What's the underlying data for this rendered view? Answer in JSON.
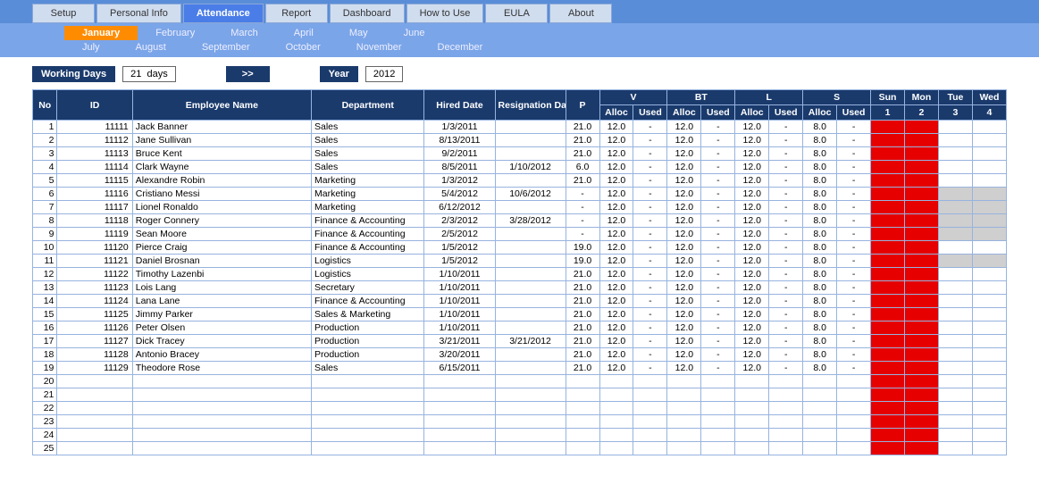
{
  "tabs": [
    "Setup",
    "Personal Info",
    "Attendance",
    "Report",
    "Dashboard",
    "How to Use",
    "EULA",
    "About"
  ],
  "activeTab": "Attendance",
  "months1": [
    "January",
    "February",
    "March",
    "April",
    "May",
    "June"
  ],
  "months2": [
    "July",
    "August",
    "September",
    "October",
    "November",
    "December"
  ],
  "activeMonth": "January",
  "controls": {
    "workingDaysLabel": "Working Days",
    "workingDaysValue": "21",
    "daysSuffix": "days",
    "nextButton": ">>",
    "yearLabel": "Year",
    "yearValue": "2012"
  },
  "headers": {
    "no": "No",
    "id": "ID",
    "name": "Employee Name",
    "dept": "Department",
    "hired": "Hired Date",
    "resig": "Resignation Date",
    "p": "P",
    "groups": [
      "V",
      "BT",
      "L",
      "S"
    ],
    "alloc": "Alloc",
    "used": "Used",
    "days": [
      "Sun",
      "Mon",
      "Tue",
      "Wed"
    ],
    "dates": [
      "1",
      "2",
      "3",
      "4"
    ]
  },
  "rows": [
    {
      "no": 1,
      "id": "11111",
      "name": "Jack Banner",
      "dept": "Sales",
      "hired": "1/3/2011",
      "resig": "",
      "p": "21.0",
      "v_a": "12.0",
      "v_u": "-",
      "bt_a": "12.0",
      "bt_u": "-",
      "l_a": "12.0",
      "l_u": "-",
      "s_a": "8.0",
      "s_u": "-",
      "d": [
        "r",
        "r",
        "",
        ""
      ]
    },
    {
      "no": 2,
      "id": "11112",
      "name": "Jane Sullivan",
      "dept": "Sales",
      "hired": "8/13/2011",
      "resig": "",
      "p": "21.0",
      "v_a": "12.0",
      "v_u": "-",
      "bt_a": "12.0",
      "bt_u": "-",
      "l_a": "12.0",
      "l_u": "-",
      "s_a": "8.0",
      "s_u": "-",
      "d": [
        "r",
        "r",
        "",
        ""
      ]
    },
    {
      "no": 3,
      "id": "11113",
      "name": "Bruce Kent",
      "dept": "Sales",
      "hired": "9/2/2011",
      "resig": "",
      "p": "21.0",
      "v_a": "12.0",
      "v_u": "-",
      "bt_a": "12.0",
      "bt_u": "-",
      "l_a": "12.0",
      "l_u": "-",
      "s_a": "8.0",
      "s_u": "-",
      "d": [
        "r",
        "r",
        "",
        ""
      ]
    },
    {
      "no": 4,
      "id": "11114",
      "name": "Clark Wayne",
      "dept": "Sales",
      "hired": "8/5/2011",
      "resig": "1/10/2012",
      "p": "6.0",
      "v_a": "12.0",
      "v_u": "-",
      "bt_a": "12.0",
      "bt_u": "-",
      "l_a": "12.0",
      "l_u": "-",
      "s_a": "8.0",
      "s_u": "-",
      "d": [
        "r",
        "r",
        "",
        ""
      ]
    },
    {
      "no": 5,
      "id": "11115",
      "name": "Alexandre Robin",
      "dept": "Marketing",
      "hired": "1/3/2012",
      "resig": "",
      "p": "21.0",
      "v_a": "12.0",
      "v_u": "-",
      "bt_a": "12.0",
      "bt_u": "-",
      "l_a": "12.0",
      "l_u": "-",
      "s_a": "8.0",
      "s_u": "-",
      "d": [
        "r",
        "r",
        "",
        ""
      ]
    },
    {
      "no": 6,
      "id": "11116",
      "name": "Cristiano Messi",
      "dept": "Marketing",
      "hired": "5/4/2012",
      "resig": "10/6/2012",
      "p": "-",
      "v_a": "12.0",
      "v_u": "-",
      "bt_a": "12.0",
      "bt_u": "-",
      "l_a": "12.0",
      "l_u": "-",
      "s_a": "8.0",
      "s_u": "-",
      "d": [
        "r",
        "r",
        "g",
        "g"
      ]
    },
    {
      "no": 7,
      "id": "11117",
      "name": "Lionel Ronaldo",
      "dept": "Marketing",
      "hired": "6/12/2012",
      "resig": "",
      "p": "-",
      "v_a": "12.0",
      "v_u": "-",
      "bt_a": "12.0",
      "bt_u": "-",
      "l_a": "12.0",
      "l_u": "-",
      "s_a": "8.0",
      "s_u": "-",
      "d": [
        "r",
        "r",
        "g",
        "g"
      ]
    },
    {
      "no": 8,
      "id": "11118",
      "name": "Roger Connery",
      "dept": "Finance & Accounting",
      "hired": "2/3/2012",
      "resig": "3/28/2012",
      "p": "-",
      "v_a": "12.0",
      "v_u": "-",
      "bt_a": "12.0",
      "bt_u": "-",
      "l_a": "12.0",
      "l_u": "-",
      "s_a": "8.0",
      "s_u": "-",
      "d": [
        "r",
        "r",
        "g",
        "g"
      ]
    },
    {
      "no": 9,
      "id": "11119",
      "name": "Sean Moore",
      "dept": "Finance & Accounting",
      "hired": "2/5/2012",
      "resig": "",
      "p": "-",
      "v_a": "12.0",
      "v_u": "-",
      "bt_a": "12.0",
      "bt_u": "-",
      "l_a": "12.0",
      "l_u": "-",
      "s_a": "8.0",
      "s_u": "-",
      "d": [
        "r",
        "r",
        "g",
        "g"
      ]
    },
    {
      "no": 10,
      "id": "11120",
      "name": "Pierce Craig",
      "dept": "Finance & Accounting",
      "hired": "1/5/2012",
      "resig": "",
      "p": "19.0",
      "v_a": "12.0",
      "v_u": "-",
      "bt_a": "12.0",
      "bt_u": "-",
      "l_a": "12.0",
      "l_u": "-",
      "s_a": "8.0",
      "s_u": "-",
      "d": [
        "r",
        "r",
        "",
        ""
      ]
    },
    {
      "no": 11,
      "id": "11121",
      "name": "Daniel Brosnan",
      "dept": "Logistics",
      "hired": "1/5/2012",
      "resig": "",
      "p": "19.0",
      "v_a": "12.0",
      "v_u": "-",
      "bt_a": "12.0",
      "bt_u": "-",
      "l_a": "12.0",
      "l_u": "-",
      "s_a": "8.0",
      "s_u": "-",
      "d": [
        "r",
        "r",
        "g",
        "g"
      ]
    },
    {
      "no": 12,
      "id": "11122",
      "name": "Timothy Lazenbi",
      "dept": "Logistics",
      "hired": "1/10/2011",
      "resig": "",
      "p": "21.0",
      "v_a": "12.0",
      "v_u": "-",
      "bt_a": "12.0",
      "bt_u": "-",
      "l_a": "12.0",
      "l_u": "-",
      "s_a": "8.0",
      "s_u": "-",
      "d": [
        "r",
        "r",
        "",
        ""
      ]
    },
    {
      "no": 13,
      "id": "11123",
      "name": "Lois Lang",
      "dept": "Secretary",
      "hired": "1/10/2011",
      "resig": "",
      "p": "21.0",
      "v_a": "12.0",
      "v_u": "-",
      "bt_a": "12.0",
      "bt_u": "-",
      "l_a": "12.0",
      "l_u": "-",
      "s_a": "8.0",
      "s_u": "-",
      "d": [
        "r",
        "r",
        "",
        ""
      ]
    },
    {
      "no": 14,
      "id": "11124",
      "name": "Lana Lane",
      "dept": "Finance & Accounting",
      "hired": "1/10/2011",
      "resig": "",
      "p": "21.0",
      "v_a": "12.0",
      "v_u": "-",
      "bt_a": "12.0",
      "bt_u": "-",
      "l_a": "12.0",
      "l_u": "-",
      "s_a": "8.0",
      "s_u": "-",
      "d": [
        "r",
        "r",
        "",
        ""
      ]
    },
    {
      "no": 15,
      "id": "11125",
      "name": "Jimmy Parker",
      "dept": "Sales & Marketing",
      "hired": "1/10/2011",
      "resig": "",
      "p": "21.0",
      "v_a": "12.0",
      "v_u": "-",
      "bt_a": "12.0",
      "bt_u": "-",
      "l_a": "12.0",
      "l_u": "-",
      "s_a": "8.0",
      "s_u": "-",
      "d": [
        "r",
        "r",
        "",
        ""
      ]
    },
    {
      "no": 16,
      "id": "11126",
      "name": "Peter Olsen",
      "dept": "Production",
      "hired": "1/10/2011",
      "resig": "",
      "p": "21.0",
      "v_a": "12.0",
      "v_u": "-",
      "bt_a": "12.0",
      "bt_u": "-",
      "l_a": "12.0",
      "l_u": "-",
      "s_a": "8.0",
      "s_u": "-",
      "d": [
        "r",
        "r",
        "",
        ""
      ]
    },
    {
      "no": 17,
      "id": "11127",
      "name": "Dick Tracey",
      "dept": "Production",
      "hired": "3/21/2011",
      "resig": "3/21/2012",
      "p": "21.0",
      "v_a": "12.0",
      "v_u": "-",
      "bt_a": "12.0",
      "bt_u": "-",
      "l_a": "12.0",
      "l_u": "-",
      "s_a": "8.0",
      "s_u": "-",
      "d": [
        "r",
        "r",
        "",
        ""
      ]
    },
    {
      "no": 18,
      "id": "11128",
      "name": "Antonio Bracey",
      "dept": "Production",
      "hired": "3/20/2011",
      "resig": "",
      "p": "21.0",
      "v_a": "12.0",
      "v_u": "-",
      "bt_a": "12.0",
      "bt_u": "-",
      "l_a": "12.0",
      "l_u": "-",
      "s_a": "8.0",
      "s_u": "-",
      "d": [
        "r",
        "r",
        "",
        ""
      ]
    },
    {
      "no": 19,
      "id": "11129",
      "name": "Theodore Rose",
      "dept": "Sales",
      "hired": "6/15/2011",
      "resig": "",
      "p": "21.0",
      "v_a": "12.0",
      "v_u": "-",
      "bt_a": "12.0",
      "bt_u": "-",
      "l_a": "12.0",
      "l_u": "-",
      "s_a": "8.0",
      "s_u": "-",
      "d": [
        "r",
        "r",
        "",
        ""
      ]
    },
    {
      "no": 20,
      "id": "",
      "name": "",
      "dept": "",
      "hired": "",
      "resig": "",
      "p": "",
      "v_a": "",
      "v_u": "",
      "bt_a": "",
      "bt_u": "",
      "l_a": "",
      "l_u": "",
      "s_a": "",
      "s_u": "",
      "d": [
        "r",
        "r",
        "",
        ""
      ]
    },
    {
      "no": 21,
      "id": "",
      "name": "",
      "dept": "",
      "hired": "",
      "resig": "",
      "p": "",
      "v_a": "",
      "v_u": "",
      "bt_a": "",
      "bt_u": "",
      "l_a": "",
      "l_u": "",
      "s_a": "",
      "s_u": "",
      "d": [
        "r",
        "r",
        "",
        ""
      ]
    },
    {
      "no": 22,
      "id": "",
      "name": "",
      "dept": "",
      "hired": "",
      "resig": "",
      "p": "",
      "v_a": "",
      "v_u": "",
      "bt_a": "",
      "bt_u": "",
      "l_a": "",
      "l_u": "",
      "s_a": "",
      "s_u": "",
      "d": [
        "r",
        "r",
        "",
        ""
      ]
    },
    {
      "no": 23,
      "id": "",
      "name": "",
      "dept": "",
      "hired": "",
      "resig": "",
      "p": "",
      "v_a": "",
      "v_u": "",
      "bt_a": "",
      "bt_u": "",
      "l_a": "",
      "l_u": "",
      "s_a": "",
      "s_u": "",
      "d": [
        "r",
        "r",
        "",
        ""
      ]
    },
    {
      "no": 24,
      "id": "",
      "name": "",
      "dept": "",
      "hired": "",
      "resig": "",
      "p": "",
      "v_a": "",
      "v_u": "",
      "bt_a": "",
      "bt_u": "",
      "l_a": "",
      "l_u": "",
      "s_a": "",
      "s_u": "",
      "d": [
        "r",
        "r",
        "",
        ""
      ]
    },
    {
      "no": 25,
      "id": "",
      "name": "",
      "dept": "",
      "hired": "",
      "resig": "",
      "p": "",
      "v_a": "",
      "v_u": "",
      "bt_a": "",
      "bt_u": "",
      "l_a": "",
      "l_u": "",
      "s_a": "",
      "s_u": "",
      "d": [
        "r",
        "r",
        "",
        ""
      ]
    }
  ]
}
